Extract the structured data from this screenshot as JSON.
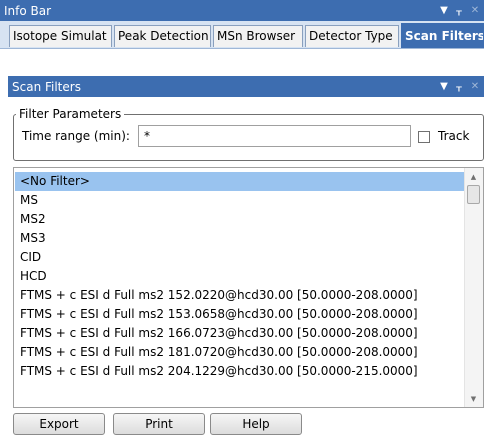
{
  "info_bar": {
    "title": "Info Bar",
    "pin_icon": "pin-icon",
    "dropdown_icon": "chevron-down-icon",
    "close_icon": "close-icon"
  },
  "tabs": [
    {
      "label": "Isotope Simulat"
    },
    {
      "label": "Peak Detection"
    },
    {
      "label": "MSn Browser"
    },
    {
      "label": "Detector Type"
    },
    {
      "label": "Scan Filters",
      "active": true
    }
  ],
  "scan_filters": {
    "title": "Scan Filters",
    "group_label": "Filter Parameters",
    "time_range_label": "Time range (min):",
    "time_range_value": "*",
    "track_label": "Track",
    "track_checked": false,
    "filters": [
      "<No Filter>",
      "MS",
      "MS2",
      "MS3",
      "CID",
      "HCD",
      "FTMS + c ESI d Full ms2 152.0220@hcd30.00 [50.0000-208.0000]",
      "FTMS + c ESI d Full ms2 153.0658@hcd30.00 [50.0000-208.0000]",
      "FTMS + c ESI d Full ms2 166.0723@hcd30.00 [50.0000-208.0000]",
      "FTMS + c ESI d Full ms2 181.0720@hcd30.00 [50.0000-208.0000]",
      "FTMS + c ESI d Full ms2 204.1229@hcd30.00 [50.0000-215.0000]"
    ],
    "selected_index": 0,
    "buttons": {
      "export": "Export",
      "print": "Print",
      "help": "Help"
    }
  },
  "colors": {
    "title_bar": "#3d6db0",
    "selection": "#99c3ef",
    "tab_strip": "#d7e3f2"
  }
}
